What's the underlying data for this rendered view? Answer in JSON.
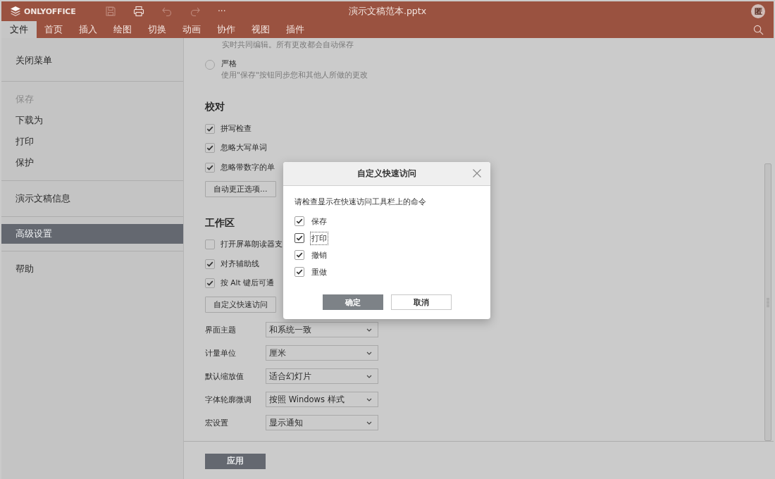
{
  "header": {
    "app_name": "ONLYOFFICE",
    "title": "演示文稿范本.pptx",
    "avatar": "匿",
    "more": "···",
    "quick_access": [
      {
        "kind": "save",
        "disabled": true
      },
      {
        "kind": "print",
        "disabled": false
      },
      {
        "kind": "undo",
        "disabled": true
      },
      {
        "kind": "redo",
        "disabled": true
      }
    ]
  },
  "tabs": [
    {
      "label": "文件",
      "selected": true
    },
    {
      "label": "首页",
      "selected": false
    },
    {
      "label": "插入",
      "selected": false
    },
    {
      "label": "绘图",
      "selected": false
    },
    {
      "label": "切换",
      "selected": false
    },
    {
      "label": "动画",
      "selected": false
    },
    {
      "label": "协作",
      "selected": false
    },
    {
      "label": "视图",
      "selected": false
    },
    {
      "label": "插件",
      "selected": false
    }
  ],
  "sidebar": {
    "groups": [
      [
        {
          "label": "关闭菜单",
          "selected": false,
          "disabled": false
        }
      ],
      [
        {
          "label": "保存",
          "selected": false,
          "disabled": true
        },
        {
          "label": "下载为",
          "selected": false,
          "disabled": false
        },
        {
          "label": "打印",
          "selected": false,
          "disabled": false
        },
        {
          "label": "保护",
          "selected": false,
          "disabled": false
        }
      ],
      [
        {
          "label": "演示文稿信息",
          "selected": false,
          "disabled": false
        }
      ],
      [
        {
          "label": "高级设置",
          "selected": true,
          "disabled": false
        }
      ],
      [
        {
          "label": "帮助",
          "selected": false,
          "disabled": false
        }
      ]
    ]
  },
  "coediting": {
    "hint": "实时共同编辑。所有更改都会自动保存",
    "options": [
      {
        "label": "严格",
        "description": "使用\"保存\"按钮同步您和其他人所做的更改",
        "selected": false
      }
    ]
  },
  "proofing": {
    "heading": "校对",
    "checks": [
      {
        "label": "拼写检查",
        "checked": true
      },
      {
        "label": "忽略大写单词",
        "checked": true
      },
      {
        "label": "忽略带数字的单",
        "checked": true
      }
    ],
    "button": "自动更正选项..."
  },
  "workspace": {
    "heading": "工作区",
    "checks": [
      {
        "label": "打开屏幕朗读器支",
        "checked": false
      },
      {
        "label": "对齐辅助线",
        "checked": true
      },
      {
        "label": "按 Alt 键后可通",
        "checked": true
      }
    ],
    "button": "自定义快速访问",
    "selects": [
      {
        "label": "界面主题",
        "value": "和系统一致"
      },
      {
        "label": "计量单位",
        "value": "厘米"
      },
      {
        "label": "默认缩放值",
        "value": "适合幻灯片"
      },
      {
        "label": "字体轮廓微调",
        "value": "按照 Windows 样式"
      },
      {
        "label": "宏设置",
        "value": "显示通知"
      }
    ]
  },
  "apply_button": "应用",
  "dialog": {
    "title": "自定义快速访问",
    "prompt": "请检查显示在快速访问工具栏上的命令",
    "items": [
      {
        "label": "保存",
        "checked": true,
        "focused": false
      },
      {
        "label": "打印",
        "checked": true,
        "focused": true
      },
      {
        "label": "撤销",
        "checked": true,
        "focused": false
      },
      {
        "label": "重做",
        "checked": true,
        "focused": false
      }
    ],
    "ok": "确定",
    "cancel": "取消"
  }
}
